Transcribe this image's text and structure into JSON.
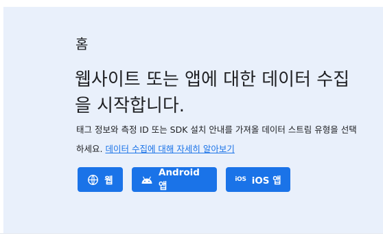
{
  "breadcrumb": "홈",
  "headline": "웹사이트 또는 앱에 대한 데이터 수집을 시작합니다.",
  "body": {
    "text": "태그 정보와 측정 ID 또는 SDK 설치 안내를 가져올 데이터 스트림 유형을 선택하세요.",
    "link": "데이터 수집에 대해 자세히 알아보기"
  },
  "buttons": {
    "web": "웹",
    "android": "Android 앱",
    "ios": "iOS 앱",
    "ios_badge": "iOS"
  },
  "colors": {
    "card_bg": "#e9f0fb",
    "primary": "#1a73e8",
    "text": "#202124"
  },
  "icons": {
    "web": "globe-icon",
    "android": "android-icon",
    "ios": "ios-icon"
  }
}
